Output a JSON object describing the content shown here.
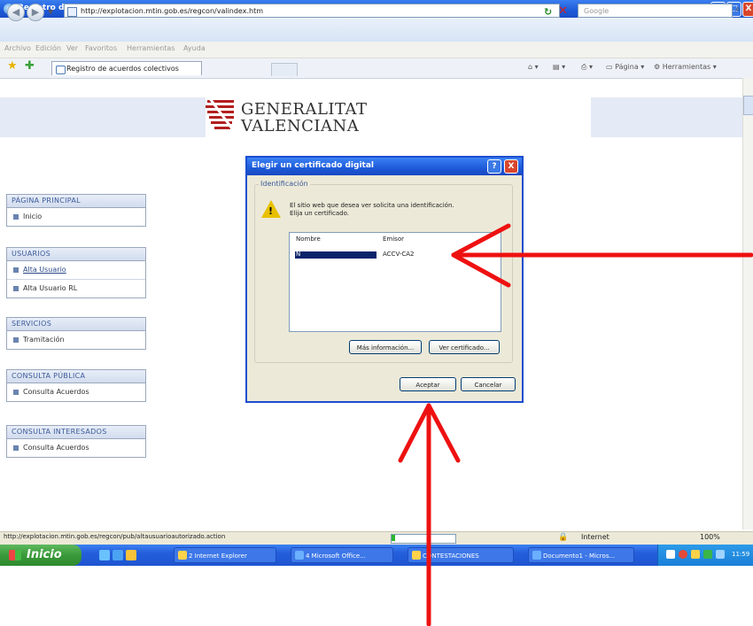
{
  "window": {
    "title": "Registro de acuerdos colectivos - Windows Internet Explorer",
    "minimize": "_",
    "maximize": "□",
    "close": "X"
  },
  "browser": {
    "url": "http://explotacion.mtin.gob.es/regcon/valindex.htm",
    "search_placeholder": "Google",
    "menu": [
      "Archivo",
      "Edición",
      "Ver",
      "Favoritos",
      "Herramientas",
      "Ayuda"
    ],
    "tab_title": "Registro de acuerdos colectivos",
    "tools": {
      "page": "Página",
      "tools": "Herramientas"
    }
  },
  "page": {
    "logo_line1": "GENERALITAT",
    "logo_line2": "VALENCIANA",
    "sidebar": [
      {
        "header": "PÁGINA PRINCIPAL",
        "items": [
          {
            "label": "Inicio",
            "link": false
          }
        ]
      },
      {
        "header": "USUARIOS",
        "items": [
          {
            "label": "Alta Usuario",
            "link": true
          },
          {
            "label": "Alta Usuario RL",
            "link": false
          }
        ]
      },
      {
        "header": "SERVICIOS",
        "items": [
          {
            "label": "Tramitación",
            "link": false
          }
        ]
      },
      {
        "header": "CONSULTA PÚBLICA",
        "items": [
          {
            "label": "Consulta Acuerdos",
            "link": false
          }
        ]
      },
      {
        "header": "CONSULTA INTERESADOS",
        "items": [
          {
            "label": "Consulta Acuerdos",
            "link": false
          }
        ]
      }
    ]
  },
  "dialog": {
    "title": "Elegir un certificado digital",
    "help": "?",
    "close": "X",
    "group_label": "Identificación",
    "message_line1": "El sitio web que desea ver solicita una identificación.",
    "message_line2": "Elija un certificado.",
    "columns": [
      "Nombre",
      "Emisor"
    ],
    "rows": [
      {
        "name": "N",
        "issuer": "ACCV-CA2"
      }
    ],
    "btn_more_info": "Más información...",
    "btn_view_cert": "Ver certificado...",
    "btn_accept": "Aceptar",
    "btn_cancel": "Cancelar"
  },
  "statusbar": {
    "url": "http://explotacion.mtin.gob.es/regcon/pub/altausuarioautorizado.action",
    "zone": "Internet",
    "zoom": "100%"
  },
  "taskbar": {
    "start": "Inicio",
    "tasks": [
      "2 Internet Explorer",
      "4 Microsoft Office...",
      "CONTESTACIONES",
      "Documento1 - Micros..."
    ],
    "clock": "11:59"
  },
  "colors": {
    "arrow": "#ee1111",
    "title_blue": "#1d5ad8",
    "selection": "#0a246a"
  }
}
